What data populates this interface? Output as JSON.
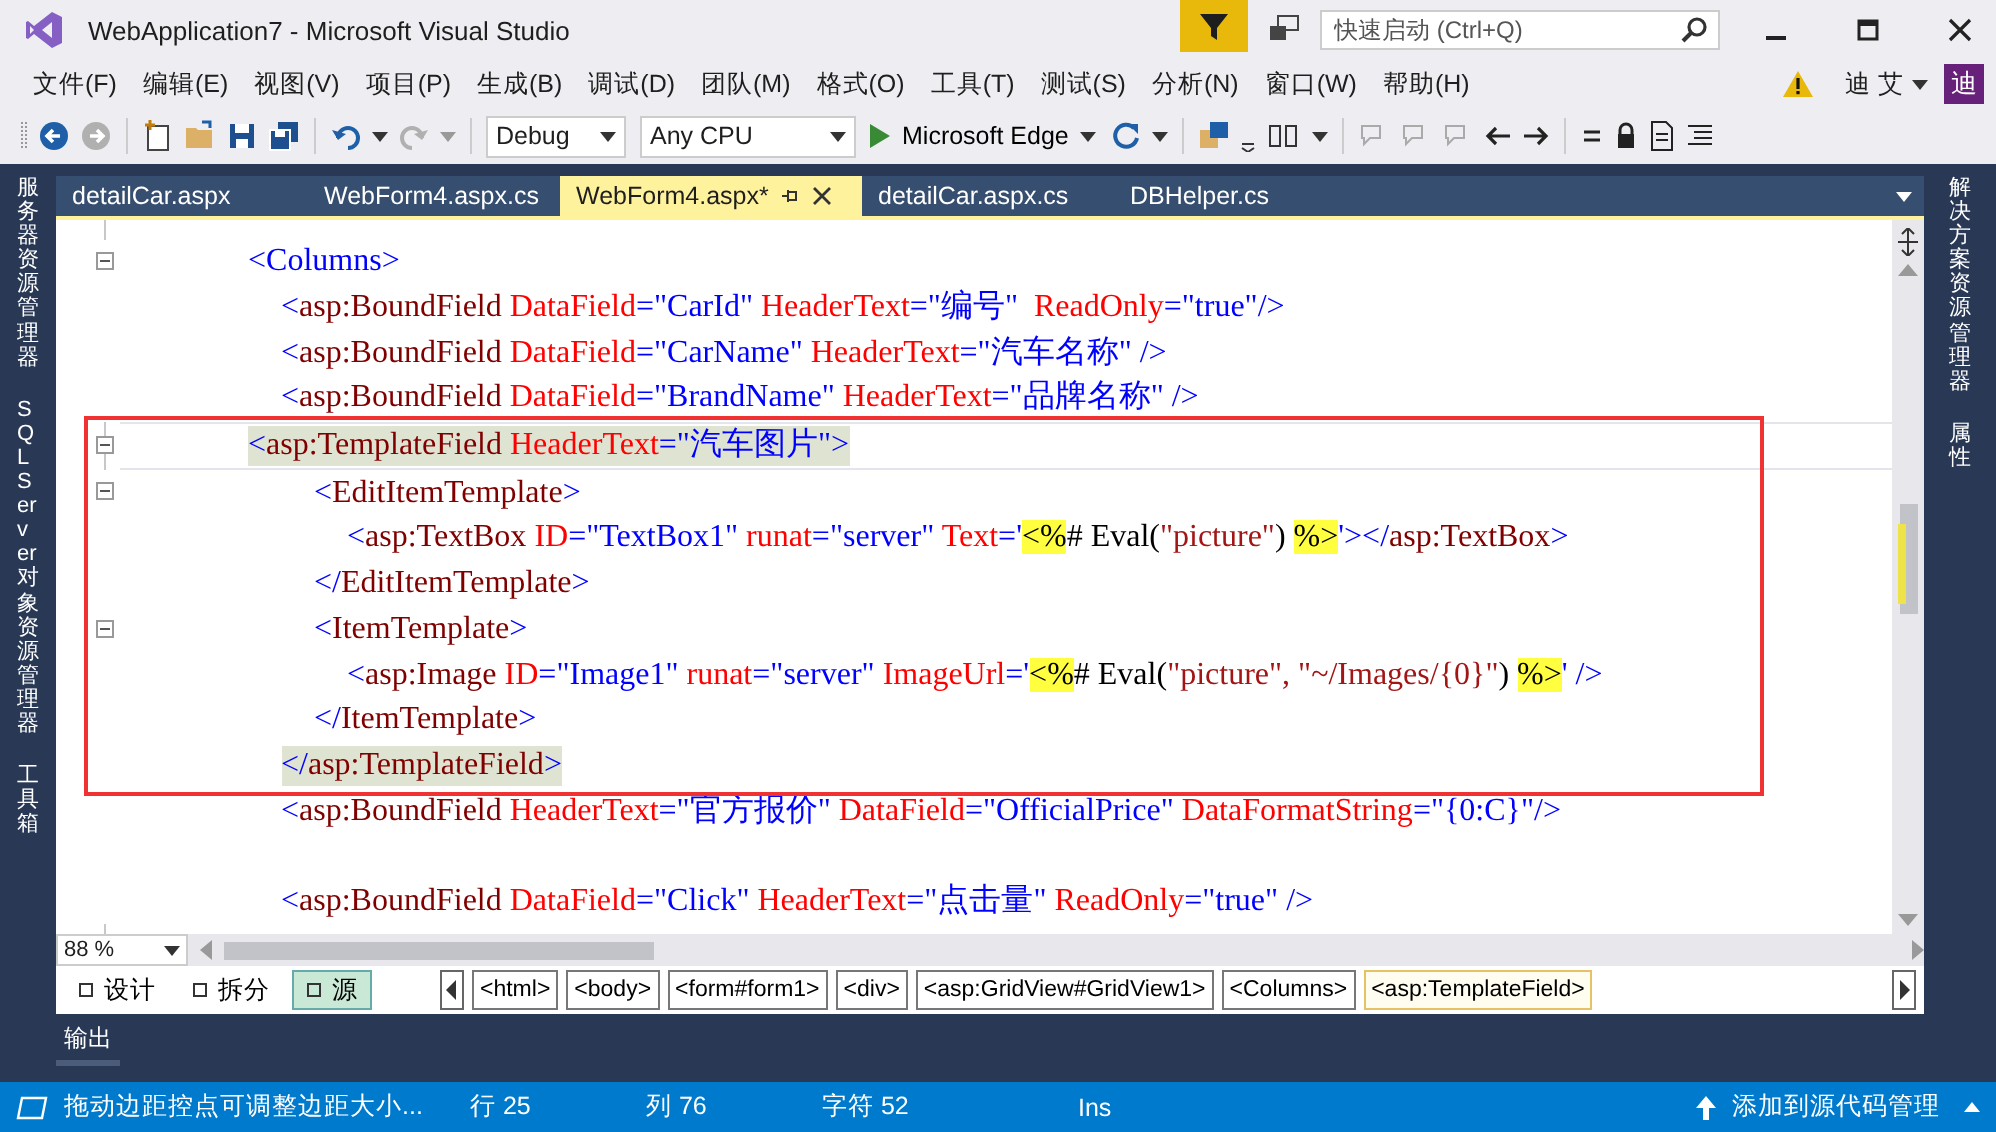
{
  "window": {
    "title": "WebApplication7 - Microsoft Visual Studio",
    "quick_launch": {
      "placeholder": "快速启动 (Ctrl+Q)"
    }
  },
  "menu": [
    "文件(F)",
    "编辑(E)",
    "视图(V)",
    "项目(P)",
    "生成(B)",
    "调试(D)",
    "团队(M)",
    "格式(O)",
    "工具(T)",
    "测试(S)",
    "分析(N)",
    "窗口(W)",
    "帮助(H)"
  ],
  "account": {
    "name": "迪 艾",
    "avatar": "迪"
  },
  "toolbar": {
    "configuration": "Debug",
    "platform": "Any CPU",
    "run_target": "Microsoft Edge"
  },
  "left_panels": [
    "服务器资源管理器",
    "SQL Server 对象资源管理器",
    "工具箱"
  ],
  "right_panels": [
    "解决方案资源管理器",
    "属性"
  ],
  "tabs": [
    {
      "label": "detailCar.aspx",
      "selected": false
    },
    {
      "label": "WebForm4.aspx.cs",
      "selected": false
    },
    {
      "label": "WebForm4.aspx*",
      "selected": true
    },
    {
      "label": "detailCar.aspx.cs",
      "selected": false
    },
    {
      "label": "DBHelper.cs",
      "selected": false
    }
  ],
  "code": [
    {
      "kind": "code",
      "current": false,
      "matched": false,
      "tokens": [
        {
          "kind": "punct",
          "text": "<Columns>"
        }
      ],
      "children": [
        {
          "kind": "code",
          "current": false,
          "matched": false,
          "tokens": [
            {
              "kind": "punct",
              "text": "<"
            },
            {
              "kind": "tag",
              "text": "asp:BoundField"
            },
            {
              "kind": "attr",
              "text": " DataField"
            },
            {
              "kind": "punct",
              "text": "="
            },
            {
              "kind": "value",
              "text": "\"CarId\""
            },
            {
              "kind": "attr",
              "text": " HeaderText"
            },
            {
              "kind": "punct",
              "text": "="
            },
            {
              "kind": "value",
              "text": "\"编号\""
            },
            {
              "kind": "attr",
              "text": "  ReadOnly"
            },
            {
              "kind": "punct",
              "text": "="
            },
            {
              "kind": "value",
              "text": "\"true\""
            },
            {
              "kind": "punct",
              "text": "/>"
            }
          ]
        },
        {
          "kind": "code",
          "current": false,
          "matched": false,
          "tokens": [
            {
              "kind": "punct",
              "text": "<"
            },
            {
              "kind": "tag",
              "text": "asp:BoundField"
            },
            {
              "kind": "attr",
              "text": " DataField"
            },
            {
              "kind": "punct",
              "text": "="
            },
            {
              "kind": "value",
              "text": "\"CarName\""
            },
            {
              "kind": "attr",
              "text": " HeaderText"
            },
            {
              "kind": "punct",
              "text": "="
            },
            {
              "kind": "value",
              "text": "\"汽车名称\""
            },
            {
              "kind": "punct",
              "text": " />"
            }
          ]
        },
        {
          "kind": "code",
          "current": false,
          "matched": false,
          "tokens": [
            {
              "kind": "punct",
              "text": "<"
            },
            {
              "kind": "tag",
              "text": "asp:BoundField"
            },
            {
              "kind": "attr",
              "text": " DataField"
            },
            {
              "kind": "punct",
              "text": "="
            },
            {
              "kind": "value",
              "text": "\"BrandName\""
            },
            {
              "kind": "attr",
              "text": " HeaderText"
            },
            {
              "kind": "punct",
              "text": "="
            },
            {
              "kind": "value",
              "text": "\"品牌名称\""
            },
            {
              "kind": "punct",
              "text": " />"
            }
          ]
        },
        {
          "kind": "code",
          "current": true,
          "matched": true,
          "tokens": [
            {
              "kind": "punct",
              "text": "<"
            },
            {
              "kind": "tag",
              "text": "asp:TemplateField"
            },
            {
              "kind": "attr",
              "text": " HeaderText"
            },
            {
              "kind": "punct",
              "text": "="
            },
            {
              "kind": "value",
              "text": "\"汽车图片\""
            },
            {
              "kind": "punct",
              "text": ">"
            }
          ],
          "children": [
            {
              "kind": "code",
              "current": false,
              "matched": false,
              "tokens": [
                {
                  "kind": "punct",
                  "text": "<"
                },
                {
                  "kind": "tag",
                  "text": "EditItemTemplate"
                },
                {
                  "kind": "punct",
                  "text": ">"
                }
              ],
              "children": [
                {
                  "kind": "code",
                  "current": false,
                  "matched": false,
                  "tokens": [
                    {
                      "kind": "punct",
                      "text": "<"
                    },
                    {
                      "kind": "tag",
                      "text": "asp:TextBox"
                    },
                    {
                      "kind": "attr",
                      "text": " ID"
                    },
                    {
                      "kind": "punct",
                      "text": "="
                    },
                    {
                      "kind": "value",
                      "text": "\"TextBox1\""
                    },
                    {
                      "kind": "attr",
                      "text": " runat"
                    },
                    {
                      "kind": "punct",
                      "text": "="
                    },
                    {
                      "kind": "value",
                      "text": "\"server\""
                    },
                    {
                      "kind": "attr",
                      "text": " Text"
                    },
                    {
                      "kind": "punct",
                      "text": "="
                    },
                    {
                      "kind": "value",
                      "text": "'"
                    },
                    {
                      "kind": "highlight",
                      "text": "<%"
                    },
                    {
                      "kind": "plain",
                      "text": "# Eval("
                    },
                    {
                      "kind": "string",
                      "text": "\"picture\""
                    },
                    {
                      "kind": "plain",
                      "text": ") "
                    },
                    {
                      "kind": "highlight",
                      "text": "%>"
                    },
                    {
                      "kind": "value",
                      "text": "'"
                    },
                    {
                      "kind": "punct",
                      "text": "></"
                    },
                    {
                      "kind": "tag",
                      "text": "asp:TextBox"
                    },
                    {
                      "kind": "punct",
                      "text": ">"
                    }
                  ]
                }
              ]
            },
            {
              "kind": "code",
              "current": false,
              "matched": false,
              "tokens": [
                {
                  "kind": "punct",
                  "text": "</"
                },
                {
                  "kind": "tag",
                  "text": "EditItemTemplate"
                },
                {
                  "kind": "punct",
                  "text": ">"
                }
              ]
            },
            {
              "kind": "code",
              "current": false,
              "matched": false,
              "tokens": [
                {
                  "kind": "punct",
                  "text": "<"
                },
                {
                  "kind": "tag",
                  "text": "ItemTemplate"
                },
                {
                  "kind": "punct",
                  "text": ">"
                }
              ],
              "children": [
                {
                  "kind": "code",
                  "current": false,
                  "matched": false,
                  "tokens": [
                    {
                      "kind": "punct",
                      "text": "<"
                    },
                    {
                      "kind": "tag",
                      "text": "asp:Image"
                    },
                    {
                      "kind": "attr",
                      "text": " ID"
                    },
                    {
                      "kind": "punct",
                      "text": "="
                    },
                    {
                      "kind": "value",
                      "text": "\"Image1\""
                    },
                    {
                      "kind": "attr",
                      "text": " runat"
                    },
                    {
                      "kind": "punct",
                      "text": "="
                    },
                    {
                      "kind": "value",
                      "text": "\"server\""
                    },
                    {
                      "kind": "attr",
                      "text": " ImageUrl"
                    },
                    {
                      "kind": "punct",
                      "text": "="
                    },
                    {
                      "kind": "value",
                      "text": "'"
                    },
                    {
                      "kind": "highlight",
                      "text": "<%"
                    },
                    {
                      "kind": "plain",
                      "text": "# Eval("
                    },
                    {
                      "kind": "string",
                      "text": "\"picture\", \"~/Images/{0}\""
                    },
                    {
                      "kind": "plain",
                      "text": ") "
                    },
                    {
                      "kind": "highlight",
                      "text": "%>"
                    },
                    {
                      "kind": "value",
                      "text": "' />"
                    }
                  ]
                }
              ]
            },
            {
              "kind": "code",
              "current": false,
              "matched": false,
              "tokens": [
                {
                  "kind": "punct",
                  "text": "</"
                },
                {
                  "kind": "tag",
                  "text": "ItemTemplate"
                },
                {
                  "kind": "punct",
                  "text": ">"
                }
              ]
            }
          ]
        },
        {
          "kind": "code",
          "current": false,
          "matched": true,
          "tokens": [
            {
              "kind": "punct",
              "text": "</"
            },
            {
              "kind": "tag",
              "text": "asp:TemplateField"
            },
            {
              "kind": "punct",
              "text": ">"
            }
          ]
        },
        {
          "kind": "code",
          "current": false,
          "matched": false,
          "tokens": [
            {
              "kind": "punct",
              "text": "<"
            },
            {
              "kind": "tag",
              "text": "asp:BoundField"
            },
            {
              "kind": "attr",
              "text": " HeaderText"
            },
            {
              "kind": "punct",
              "text": "="
            },
            {
              "kind": "value",
              "text": "\"官方报价\""
            },
            {
              "kind": "attr",
              "text": " DataField"
            },
            {
              "kind": "punct",
              "text": "="
            },
            {
              "kind": "value",
              "text": "\"OfficialPrice\""
            },
            {
              "kind": "attr",
              "text": " DataFormatString"
            },
            {
              "kind": "punct",
              "text": "="
            },
            {
              "kind": "value",
              "text": "\"{0:C}\"/>"
            }
          ]
        },
        {
          "kind": "blank"
        },
        {
          "kind": "code",
          "current": false,
          "matched": false,
          "tokens": [
            {
              "kind": "punct",
              "text": "<"
            },
            {
              "kind": "tag",
              "text": "asp:BoundField"
            },
            {
              "kind": "attr",
              "text": " DataField"
            },
            {
              "kind": "punct",
              "text": "="
            },
            {
              "kind": "value",
              "text": "\"Click\""
            },
            {
              "kind": "attr",
              "text": " HeaderText"
            },
            {
              "kind": "punct",
              "text": "="
            },
            {
              "kind": "value",
              "text": "\"点击量\""
            },
            {
              "kind": "attr",
              "text": " ReadOnly"
            },
            {
              "kind": "punct",
              "text": "="
            },
            {
              "kind": "value",
              "text": "\"true\""
            },
            {
              "kind": "punct",
              "text": " />"
            }
          ]
        }
      ]
    }
  ],
  "zoom": "88 %",
  "views": [
    {
      "label": "设计",
      "selected": false
    },
    {
      "label": "拆分",
      "selected": false
    },
    {
      "label": "源",
      "selected": true
    }
  ],
  "breadcrumbs": [
    {
      "label": "<html>",
      "selected": false
    },
    {
      "label": "<body>",
      "selected": false
    },
    {
      "label": "<form#form1>",
      "selected": false
    },
    {
      "label": "<div>",
      "selected": false
    },
    {
      "label": "<asp:GridView#GridView1>",
      "selected": false
    },
    {
      "label": "<Columns>",
      "selected": false
    },
    {
      "label": "<asp:TemplateField>",
      "selected": true
    }
  ],
  "output_tab": "输出",
  "status_bar": {
    "message": "拖动边距控点可调整边距大小...",
    "line": "行 25",
    "column": "列 76",
    "char": "字符 52",
    "mode": "Ins",
    "source_control": "添加到源代码管理"
  }
}
